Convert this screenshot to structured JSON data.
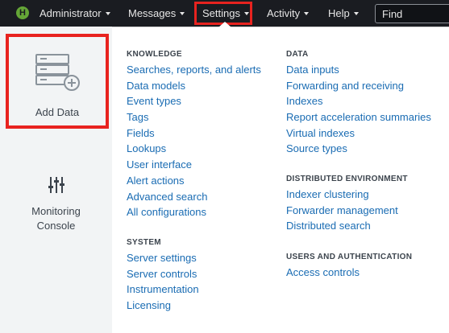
{
  "topbar": {
    "logo_letter": "H",
    "nav": [
      {
        "label": "Administrator"
      },
      {
        "label": "Messages"
      },
      {
        "label": "Settings"
      },
      {
        "label": "Activity"
      },
      {
        "label": "Help"
      }
    ],
    "search": {
      "placeholder": "Find"
    }
  },
  "left_rail": {
    "add_data_label": "Add Data",
    "monitoring_label_line1": "Monitoring",
    "monitoring_label_line2": "Console"
  },
  "sections": {
    "knowledge": {
      "title": "KNOWLEDGE",
      "items": [
        "Searches, reports, and alerts",
        "Data models",
        "Event types",
        "Tags",
        "Fields",
        "Lookups",
        "User interface",
        "Alert actions",
        "Advanced search",
        "All configurations"
      ]
    },
    "system": {
      "title": "SYSTEM",
      "items": [
        "Server settings",
        "Server controls",
        "Instrumentation",
        "Licensing"
      ]
    },
    "data": {
      "title": "DATA",
      "items": [
        "Data inputs",
        "Forwarding and receiving",
        "Indexes",
        "Report acceleration summaries",
        "Virtual indexes",
        "Source types"
      ]
    },
    "distributed": {
      "title": "DISTRIBUTED ENVIRONMENT",
      "items": [
        "Indexer clustering",
        "Forwarder management",
        "Distributed search"
      ]
    },
    "users": {
      "title": "USERS AND AUTHENTICATION",
      "items": [
        "Access controls"
      ]
    }
  }
}
